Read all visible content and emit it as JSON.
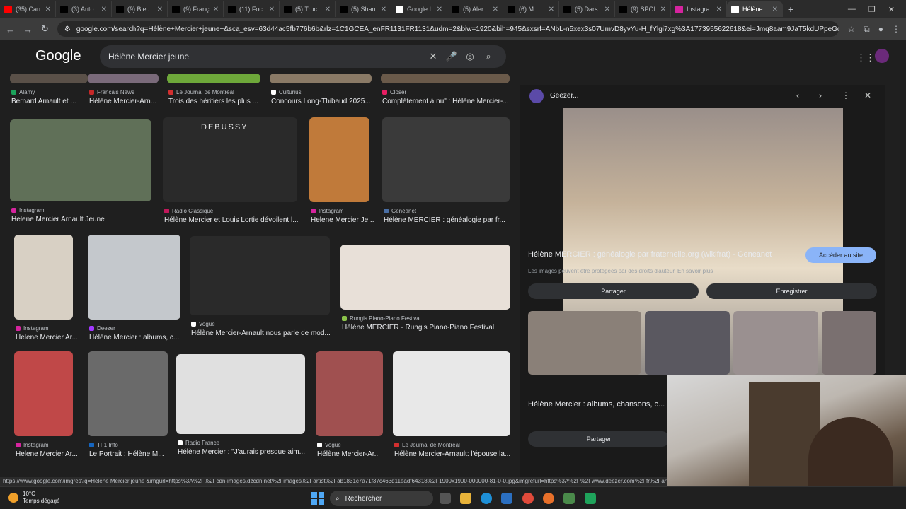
{
  "tabs": [
    {
      "label": "(35) Can",
      "icon": "youtube-icon",
      "color": "#ff0000"
    },
    {
      "label": "(3) Anto",
      "icon": "x-icon",
      "color": "#000000"
    },
    {
      "label": "(9) Bleu",
      "icon": "x-icon",
      "color": "#000000"
    },
    {
      "label": "(9) Franç",
      "icon": "x-icon",
      "color": "#000000"
    },
    {
      "label": "(11) Foc",
      "icon": "x-icon",
      "color": "#000000"
    },
    {
      "label": "(5) Truc",
      "icon": "x-icon",
      "color": "#000000"
    },
    {
      "label": "(5) Shan",
      "icon": "x-icon",
      "color": "#000000"
    },
    {
      "label": "Google I",
      "icon": "google-icon",
      "color": "#ffffff"
    },
    {
      "label": "(5) Aler",
      "icon": "x-icon",
      "color": "#000000"
    },
    {
      "label": "(6) M",
      "icon": "x-icon",
      "color": "#000000"
    },
    {
      "label": "(5) Dars",
      "icon": "x-icon",
      "color": "#000000"
    },
    {
      "label": "(9) SPOI",
      "icon": "x-icon",
      "color": "#000000"
    },
    {
      "label": "Instagra",
      "icon": "instagram-icon",
      "color": "#d6249f"
    },
    {
      "label": "Hélène",
      "icon": "google-icon",
      "color": "#ffffff",
      "active": true
    }
  ],
  "address": {
    "url": "google.com/search?q=Hélène+Mercier+jeune+&sca_esv=63d44ac5fb776b6b&rlz=1C1GCEA_enFR1131FR1131&udm=2&biw=1920&bih=945&sxsrf=ANbL-n5xex3s07UmvD8yvYu-H_fYlgi7xg%3A1773955622618&ei=Jmq8aam9JaT5kdUPpeGdwQg&..."
  },
  "google": {
    "logo": "Google",
    "query": "Hélène Mercier jeune"
  },
  "results": [
    {
      "source": "Alamy",
      "title": "Bernard Arnault et ...",
      "srcColor": "#1ba35b",
      "imgColor": "#5a5048"
    },
    {
      "source": "Francais News",
      "title": "Hélène Mercier-Arn...",
      "srcColor": "#c62828",
      "imgColor": "#7a6a7a"
    },
    {
      "source": "Le Journal de Montréal",
      "title": "Trois des héritiers les plus ...",
      "srcColor": "#d32f2f",
      "imgColor": "#6ea83a"
    },
    {
      "source": "Culturius",
      "title": "Concours Long-Thibaud 2025...",
      "srcColor": "#ffffff",
      "imgColor": "#8a7a66"
    },
    {
      "source": "Closer",
      "title": "Complètement à nu\" : Hélène Mercier-...",
      "srcColor": "#e91e63",
      "imgColor": "#6a5a4a"
    },
    {
      "source": "Instagram",
      "title": "Helene Mercier Arnault Jeune",
      "srcColor": "#d6249f",
      "imgColor": "#607058"
    },
    {
      "source": "Radio Classique",
      "title": "Hélène Mercier et Louis Lortie dévoilent l...",
      "srcColor": "#c2185b",
      "imgColor": "#2a2a2a",
      "caption": "DEBUSSY"
    },
    {
      "source": "Instagram",
      "title": "Helene Mercier Je...",
      "srcColor": "#d6249f",
      "imgColor": "#c07a3a"
    },
    {
      "source": "Geneanet",
      "title": "Hélène MERCIER : généalogie par fr...",
      "srcColor": "#4a6fa5",
      "imgColor": "#3a3a3a"
    },
    {
      "source": "Instagram",
      "title": "Helene Mercier Ar...",
      "srcColor": "#d6249f",
      "imgColor": "#d8d0c4"
    },
    {
      "source": "Deezer",
      "title": "Hélène Mercier : albums, c...",
      "srcColor": "#a238ff",
      "imgColor": "#c4c8cc"
    },
    {
      "source": "Vogue",
      "title": "Hélène Mercier-Arnault nous parle de mod...",
      "srcColor": "#ffffff",
      "imgColor": "#2a2a2a"
    },
    {
      "source": "Rungis Piano-Piano Festival",
      "title": "Hélène MERCIER - Rungis Piano-Piano Festival",
      "srcColor": "#8bc34a",
      "imgColor": "#e8e0d8"
    },
    {
      "source": "Instagram",
      "title": "Helene Mercier Ar...",
      "srcColor": "#d6249f",
      "imgColor": "#c04848"
    },
    {
      "source": "TF1 Info",
      "title": "Le Portrait : Hélène M...",
      "srcColor": "#1565c0",
      "imgColor": "#6a6a6a"
    },
    {
      "source": "Radio France",
      "title": "Hélène Mercier : \"J'aurais presque aim...",
      "srcColor": "#ffffff",
      "imgColor": "#e0e0e0"
    },
    {
      "source": "Vogue",
      "title": "Hélène Mercier-Ar...",
      "srcColor": "#ffffff",
      "imgColor": "#a05050"
    },
    {
      "source": "Le Journal de Montréal",
      "title": "Hélène Mercier-Arnault: l'épouse la...",
      "srcColor": "#d32f2f",
      "imgColor": "#e8e8e8"
    }
  ],
  "side": {
    "source": "Geezer...",
    "title": "Hélène MERCIER : généalogie par fraternelle.org (wikifrat) - Geneanet",
    "visit": "Accéder au site",
    "note": "Les images peuvent être protégées par des droits d'auteur. En savoir plus",
    "share": "Partager",
    "save": "Enregistrer",
    "related_title": "Hélène Mercier : albums, chansons, c...",
    "related_share": "Partager",
    "related_colors": [
      "#8a8078",
      "#5a5860",
      "#9a9090",
      "#7a7070"
    ]
  },
  "status_url": "https://www.google.com/imgres?q=Hélène Mercier jeune &imgurl=https%3A%2F%2Fcdn-images.dzcdn.net%2Fimages%2Fartist%2Fab1831c7a71f37c463d11eadf64318%2F1900x1900-000000-81-0-0.jpg&imgrefurl=https%3A%2F%2Fwww.deezer.com%2Ffr%2Fartis",
  "taskbar": {
    "temp": "10°C",
    "weather": "Temps dégagé",
    "search": "Rechercher"
  }
}
